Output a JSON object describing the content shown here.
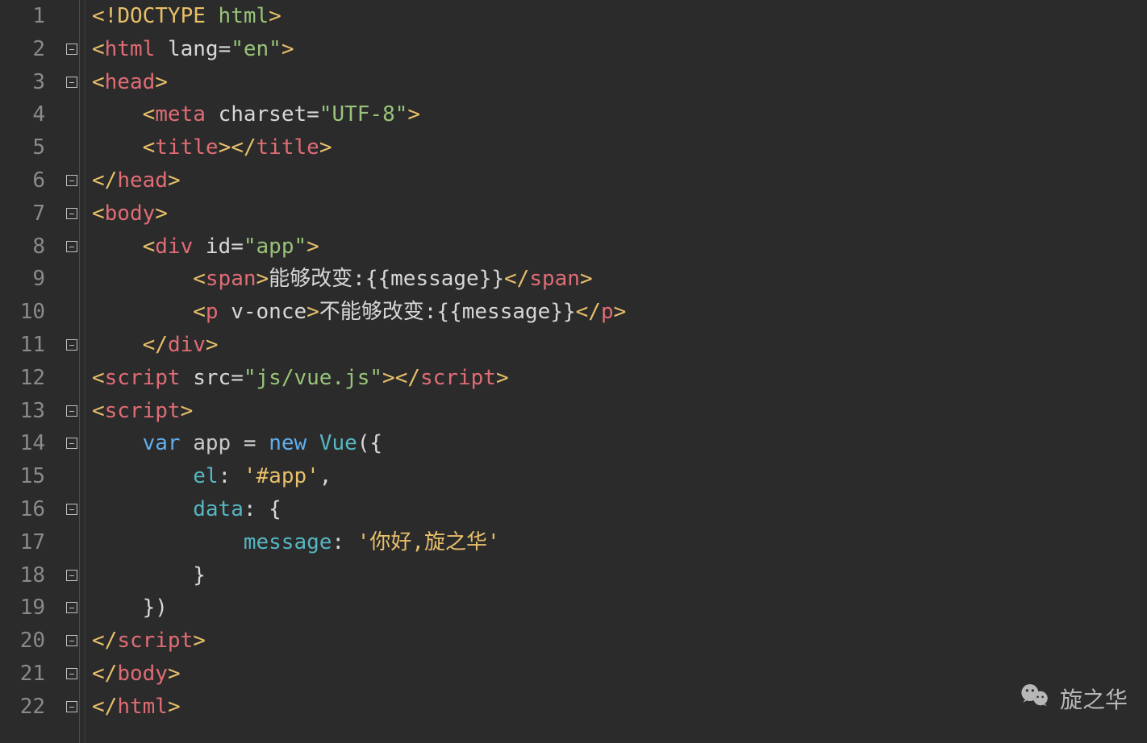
{
  "watermark": {
    "text": "旋之华"
  },
  "lines": [
    {
      "n": "1",
      "tokens": [
        [
          "<!",
          "orange"
        ],
        [
          "DOCTYPE ",
          "orange"
        ],
        [
          "html",
          "green"
        ],
        [
          ">",
          "orange"
        ]
      ]
    },
    {
      "n": "2",
      "fold": "open",
      "tokens": [
        [
          "<",
          "orange"
        ],
        [
          "html ",
          "pink"
        ],
        [
          "lang",
          "white"
        ],
        [
          "=",
          "white"
        ],
        [
          "\"en\"",
          "green"
        ],
        [
          ">",
          "orange"
        ]
      ]
    },
    {
      "n": "3",
      "fold": "open",
      "tokens": [
        [
          "<",
          "orange"
        ],
        [
          "head",
          "pink"
        ],
        [
          ">",
          "orange"
        ]
      ]
    },
    {
      "n": "4",
      "indent": 1,
      "tokens": [
        [
          "<",
          "orange"
        ],
        [
          "meta ",
          "pink"
        ],
        [
          "charset",
          "white"
        ],
        [
          "=",
          "white"
        ],
        [
          "\"UTF-8\"",
          "green"
        ],
        [
          ">",
          "orange"
        ]
      ]
    },
    {
      "n": "5",
      "indent": 1,
      "tokens": [
        [
          "<",
          "orange"
        ],
        [
          "title",
          "pink"
        ],
        [
          ">",
          "orange"
        ],
        [
          "</",
          "orange"
        ],
        [
          "title",
          "pink"
        ],
        [
          ">",
          "orange"
        ]
      ]
    },
    {
      "n": "6",
      "fold": "close",
      "tokens": [
        [
          "</",
          "orange"
        ],
        [
          "head",
          "pink"
        ],
        [
          ">",
          "orange"
        ]
      ]
    },
    {
      "n": "7",
      "fold": "open",
      "tokens": [
        [
          "<",
          "orange"
        ],
        [
          "body",
          "pink"
        ],
        [
          ">",
          "orange"
        ]
      ]
    },
    {
      "n": "8",
      "fold": "open",
      "indent": 1,
      "tokens": [
        [
          "<",
          "orange"
        ],
        [
          "div ",
          "pink"
        ],
        [
          "id",
          "white"
        ],
        [
          "=",
          "white"
        ],
        [
          "\"app\"",
          "green"
        ],
        [
          ">",
          "orange"
        ]
      ]
    },
    {
      "n": "9",
      "indent": 2,
      "tokens": [
        [
          "<",
          "orange"
        ],
        [
          "span",
          "pink"
        ],
        [
          ">",
          "orange"
        ],
        [
          "能够改变:{{message}}",
          "white"
        ],
        [
          "</",
          "orange"
        ],
        [
          "span",
          "pink"
        ],
        [
          ">",
          "orange"
        ]
      ]
    },
    {
      "n": "10",
      "indent": 2,
      "tokens": [
        [
          "<",
          "orange"
        ],
        [
          "p ",
          "pink"
        ],
        [
          "v-once",
          "white"
        ],
        [
          ">",
          "orange"
        ],
        [
          "不能够改变:{{message}}",
          "white"
        ],
        [
          "</",
          "orange"
        ],
        [
          "p",
          "pink"
        ],
        [
          ">",
          "orange"
        ]
      ]
    },
    {
      "n": "11",
      "fold": "close",
      "indent": 1,
      "tokens": [
        [
          "</",
          "orange"
        ],
        [
          "div",
          "pink"
        ],
        [
          ">",
          "orange"
        ]
      ]
    },
    {
      "n": "12",
      "tokens": [
        [
          "<",
          "orange"
        ],
        [
          "script ",
          "pink"
        ],
        [
          "src",
          "white"
        ],
        [
          "=",
          "white"
        ],
        [
          "\"js/vue.js\"",
          "green"
        ],
        [
          ">",
          "orange"
        ],
        [
          "</",
          "orange"
        ],
        [
          "script",
          "pink"
        ],
        [
          ">",
          "orange"
        ]
      ]
    },
    {
      "n": "13",
      "fold": "open",
      "tokens": [
        [
          "<",
          "orange"
        ],
        [
          "script",
          "pink"
        ],
        [
          ">",
          "orange"
        ]
      ]
    },
    {
      "n": "14",
      "fold": "open",
      "indent": 1,
      "tokens": [
        [
          "var ",
          "kw"
        ],
        [
          "app ",
          "fn"
        ],
        [
          "= ",
          "white"
        ],
        [
          "new ",
          "kw"
        ],
        [
          "Vue",
          "fn"
        ],
        [
          "({",
          "white"
        ]
      ]
    },
    {
      "n": "15",
      "indent": 2,
      "tokens": [
        [
          "el",
          "teal"
        ],
        [
          ": ",
          "white"
        ],
        [
          "'#app'",
          "str2"
        ],
        [
          ",",
          "white"
        ]
      ]
    },
    {
      "n": "16",
      "fold": "open",
      "indent": 2,
      "tokens": [
        [
          "data",
          "teal"
        ],
        [
          ": {",
          "white"
        ]
      ]
    },
    {
      "n": "17",
      "indent": 3,
      "tokens": [
        [
          "message",
          "teal"
        ],
        [
          ": ",
          "white"
        ],
        [
          "'你好,旋之华'",
          "str2"
        ]
      ]
    },
    {
      "n": "18",
      "fold": "close",
      "indent": 2,
      "tokens": [
        [
          "}",
          "white"
        ]
      ]
    },
    {
      "n": "19",
      "fold": "close",
      "indent": 1,
      "tokens": [
        [
          "})",
          "white"
        ]
      ]
    },
    {
      "n": "20",
      "fold": "close",
      "tokens": [
        [
          "</",
          "orange"
        ],
        [
          "script",
          "pink"
        ],
        [
          ">",
          "orange"
        ]
      ]
    },
    {
      "n": "21",
      "fold": "close",
      "tokens": [
        [
          "</",
          "orange"
        ],
        [
          "body",
          "pink"
        ],
        [
          ">",
          "orange"
        ]
      ]
    },
    {
      "n": "22",
      "fold": "close",
      "tokens": [
        [
          "</",
          "orange"
        ],
        [
          "html",
          "pink"
        ],
        [
          ">",
          "orange"
        ]
      ]
    }
  ]
}
